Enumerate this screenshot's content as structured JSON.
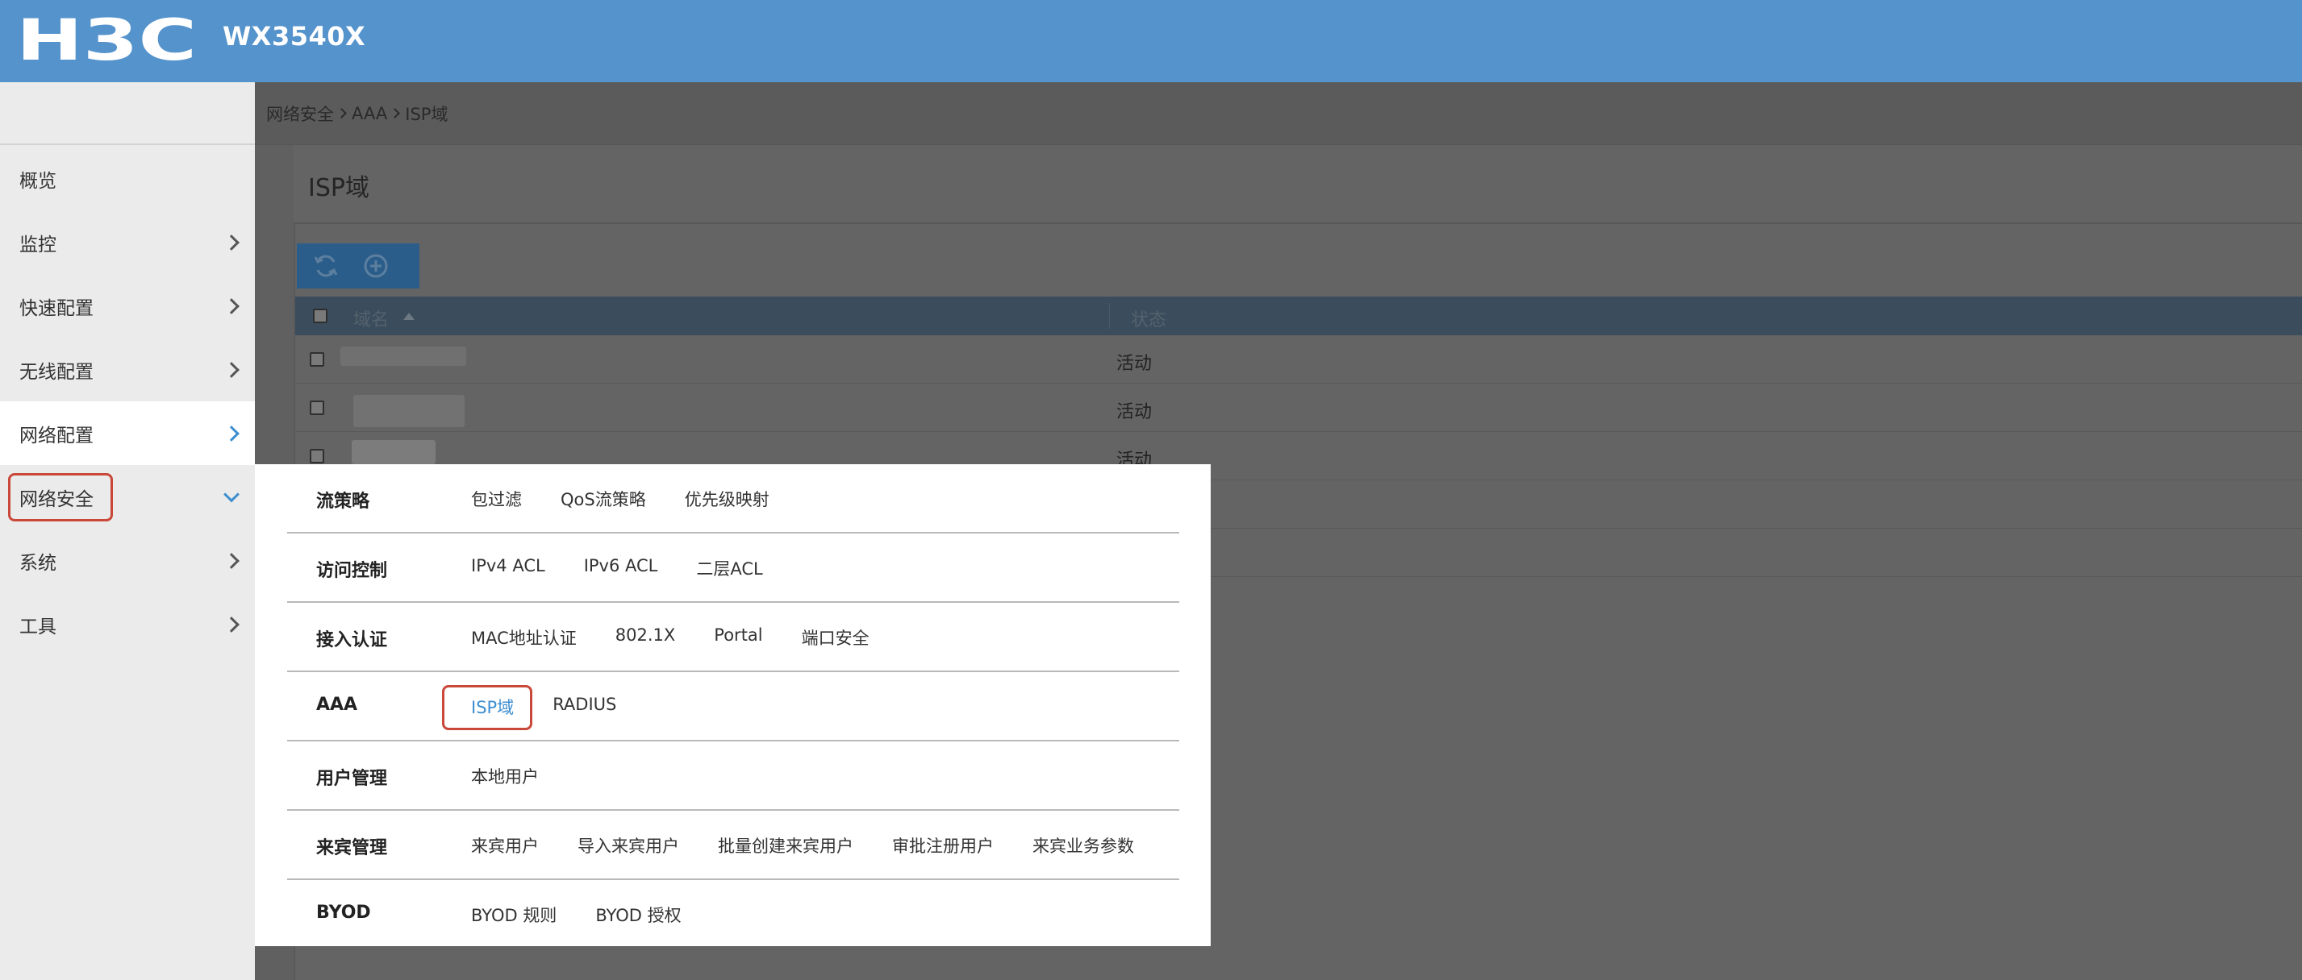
{
  "header": {
    "brand": "H3C",
    "device_model": "WX3540X",
    "color": "#5593cc"
  },
  "sidebar": {
    "items": [
      {
        "label": "概览",
        "has_arrow": false
      },
      {
        "label": "监控",
        "has_arrow": true
      },
      {
        "label": "快速配置",
        "has_arrow": true
      },
      {
        "label": "无线配置",
        "has_arrow": true
      },
      {
        "label": "网络配置",
        "has_arrow": true
      },
      {
        "label": "网络安全",
        "has_arrow": true,
        "expanded": true
      },
      {
        "label": "系统",
        "has_arrow": true
      },
      {
        "label": "工具",
        "has_arrow": true
      }
    ]
  },
  "breadcrumb": [
    "网络安全",
    "AAA",
    "ISP域"
  ],
  "page": {
    "title": "ISP域",
    "toolbar": {
      "refresh_icon": "refresh-icon",
      "add_icon": "add-circle-icon"
    },
    "table": {
      "columns": [
        "域名",
        "状态"
      ],
      "rows": [
        {
          "name": "",
          "status": "活动"
        },
        {
          "name": "",
          "status": "活动"
        },
        {
          "name": "",
          "status": "活动"
        }
      ]
    }
  },
  "menu": {
    "rows": [
      {
        "category": "流策略",
        "links": [
          "包过滤",
          "QoS流策略",
          "优先级映射"
        ]
      },
      {
        "category": "访问控制",
        "links": [
          "IPv4 ACL",
          "IPv6 ACL",
          "二层ACL"
        ]
      },
      {
        "category": "接入认证",
        "links": [
          "MAC地址认证",
          "802.1X",
          "Portal",
          "端口安全"
        ]
      },
      {
        "category": "AAA",
        "links": [
          "ISP域",
          "RADIUS"
        ]
      },
      {
        "category": "用户管理",
        "links": [
          "本地用户"
        ]
      },
      {
        "category": "来宾管理",
        "links": [
          "来宾用户",
          "导入来宾用户",
          "批量创建来宾用户",
          "审批注册用户",
          "来宾业务参数"
        ]
      },
      {
        "category": "BYOD",
        "links": [
          "BYOD 规则",
          "BYOD 授权"
        ]
      }
    ],
    "selected_color": "#3d8ed0",
    "highlight_color": "#c9483a"
  }
}
